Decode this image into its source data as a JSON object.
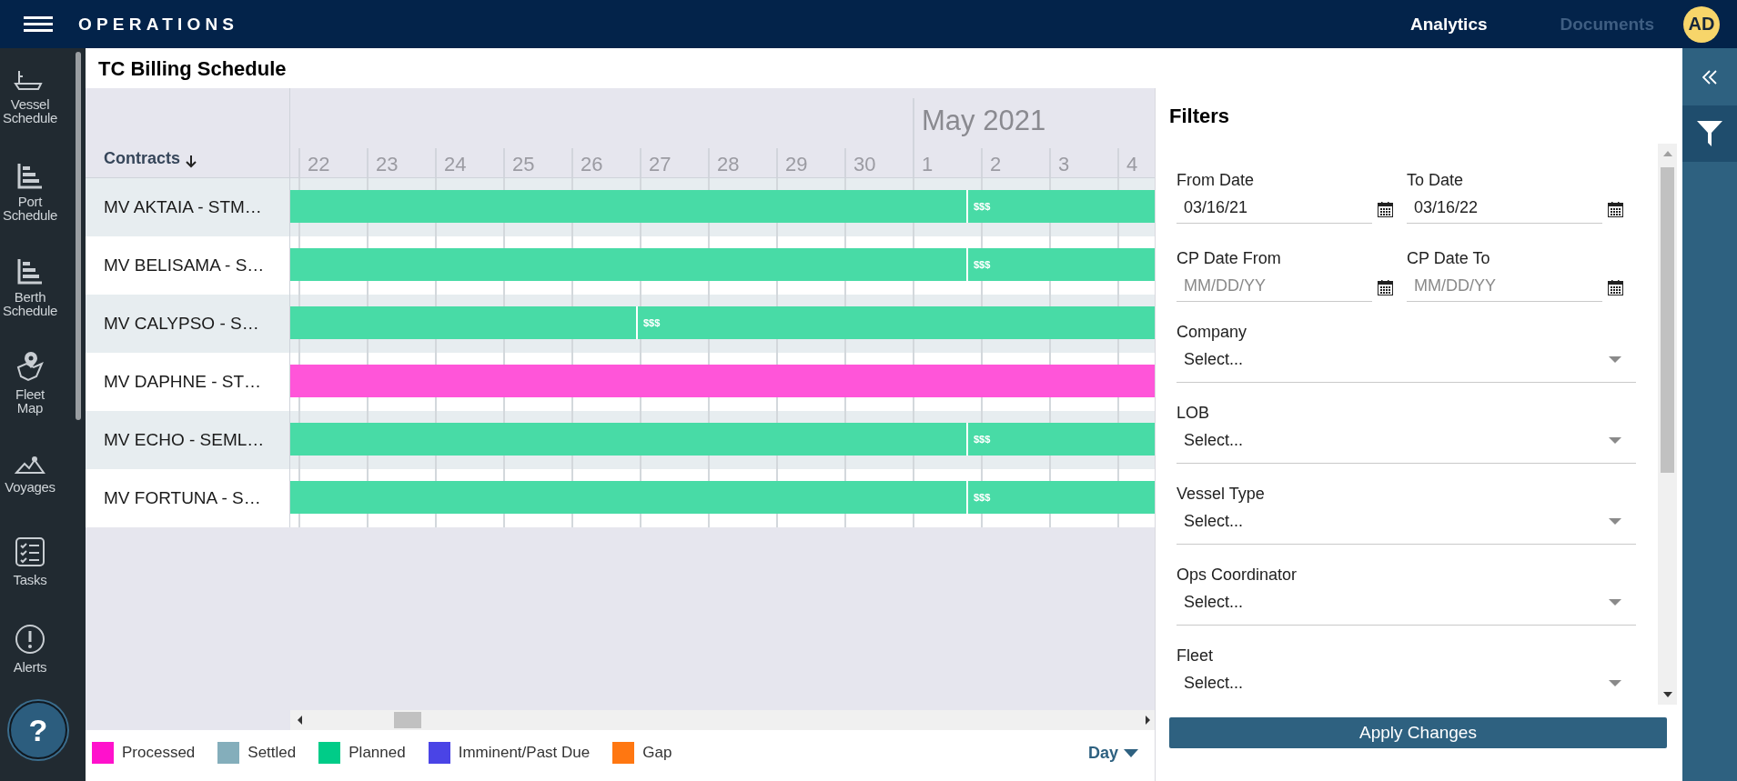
{
  "header": {
    "app_title": "OPERATIONS",
    "nav": [
      {
        "label": "Analytics",
        "selected": true
      },
      {
        "label": "Documents",
        "selected": false
      }
    ],
    "avatar": "AD"
  },
  "sidebar": {
    "items": [
      {
        "label": "Vessel Schedule"
      },
      {
        "label": "Port Schedule"
      },
      {
        "label": "Berth Schedule"
      },
      {
        "label": "Fleet Map"
      },
      {
        "label": "Voyages"
      },
      {
        "label": "Tasks"
      },
      {
        "label": "Alerts"
      }
    ],
    "help": "?"
  },
  "page_title": "TC Billing Schedule",
  "gantt": {
    "column_header": "Contracts",
    "days": [
      {
        "label": "22"
      },
      {
        "label": "23"
      },
      {
        "label": "24"
      },
      {
        "label": "25"
      },
      {
        "label": "26"
      },
      {
        "label": "27"
      },
      {
        "label": "28"
      },
      {
        "label": "29"
      },
      {
        "label": "30"
      },
      {
        "label": "1",
        "month": "May 2021"
      },
      {
        "label": "2"
      },
      {
        "label": "3"
      },
      {
        "label": "4"
      }
    ],
    "rows": [
      {
        "name": "MV AKTAIA - STM…",
        "segments": [
          {
            "color": "#48dba6"
          },
          {
            "color": "#48dba6",
            "label": "$$$"
          }
        ]
      },
      {
        "name": "MV BELISAMA - S…",
        "segments": [
          {
            "color": "#48dba6"
          },
          {
            "color": "#48dba6",
            "label": "$$$"
          }
        ]
      },
      {
        "name": "MV CALYPSO - S…",
        "segments": [
          {
            "color": "#48dba6"
          },
          {
            "color": "#48dba6",
            "label": "$$$"
          }
        ]
      },
      {
        "name": "MV DAPHNE - ST…",
        "segments": [
          {
            "color": "#ff55d9"
          }
        ]
      },
      {
        "name": "MV ECHO - SEML…",
        "segments": [
          {
            "color": "#48dba6"
          },
          {
            "color": "#48dba6",
            "label": "$$$"
          }
        ]
      },
      {
        "name": "MV FORTUNA - S…",
        "segments": [
          {
            "color": "#48dba6"
          },
          {
            "color": "#48dba6",
            "label": "$$$"
          }
        ]
      }
    ],
    "legend": [
      {
        "label": "Processed",
        "color": "#ff11cc"
      },
      {
        "label": "Settled",
        "color": "#84aebb"
      },
      {
        "label": "Planned",
        "color": "#00cc88"
      },
      {
        "label": "Imminent/Past Due",
        "color": "#4a44e6"
      },
      {
        "label": "Gap",
        "color": "#ff7711"
      }
    ],
    "scale": "Day"
  },
  "filters": {
    "title": "Filters",
    "date_fields": [
      {
        "label": "From Date",
        "value": "03/16/21"
      },
      {
        "label": "To Date",
        "value": "03/16/22"
      },
      {
        "label": "CP Date From",
        "placeholder": "MM/DD/YY"
      },
      {
        "label": "CP Date To",
        "placeholder": "MM/DD/YY"
      }
    ],
    "selects": [
      {
        "label": "Company",
        "placeholder": "Select..."
      },
      {
        "label": "LOB",
        "placeholder": "Select..."
      },
      {
        "label": "Vessel Type",
        "placeholder": "Select..."
      },
      {
        "label": "Ops Coordinator",
        "placeholder": "Select..."
      },
      {
        "label": "Fleet",
        "placeholder": "Select..."
      }
    ],
    "apply": "Apply Changes"
  }
}
